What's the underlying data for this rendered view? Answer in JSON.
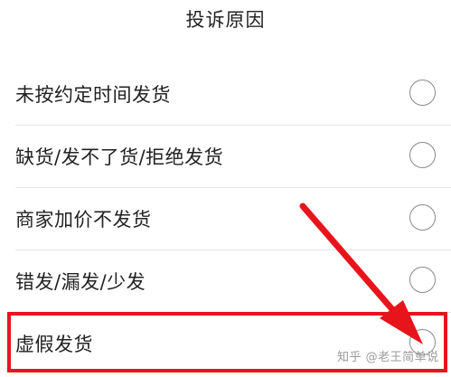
{
  "header": {
    "title": "投诉原因"
  },
  "options": [
    {
      "label": "未按约定时间发货",
      "selected": false
    },
    {
      "label": "缺货/发不了货/拒绝发货",
      "selected": false
    },
    {
      "label": "商家加价不发货",
      "selected": false
    },
    {
      "label": "错发/漏发/少发",
      "selected": false
    },
    {
      "label": "虚假发货",
      "selected": false
    }
  ],
  "annotation": {
    "color": "#e8141c",
    "highlighted_option": "虚假发货"
  },
  "watermark": {
    "text": "知乎 @老王简单说"
  },
  "icons": {
    "radio": "radio-circle-icon",
    "arrow": "red-arrow-icon"
  }
}
